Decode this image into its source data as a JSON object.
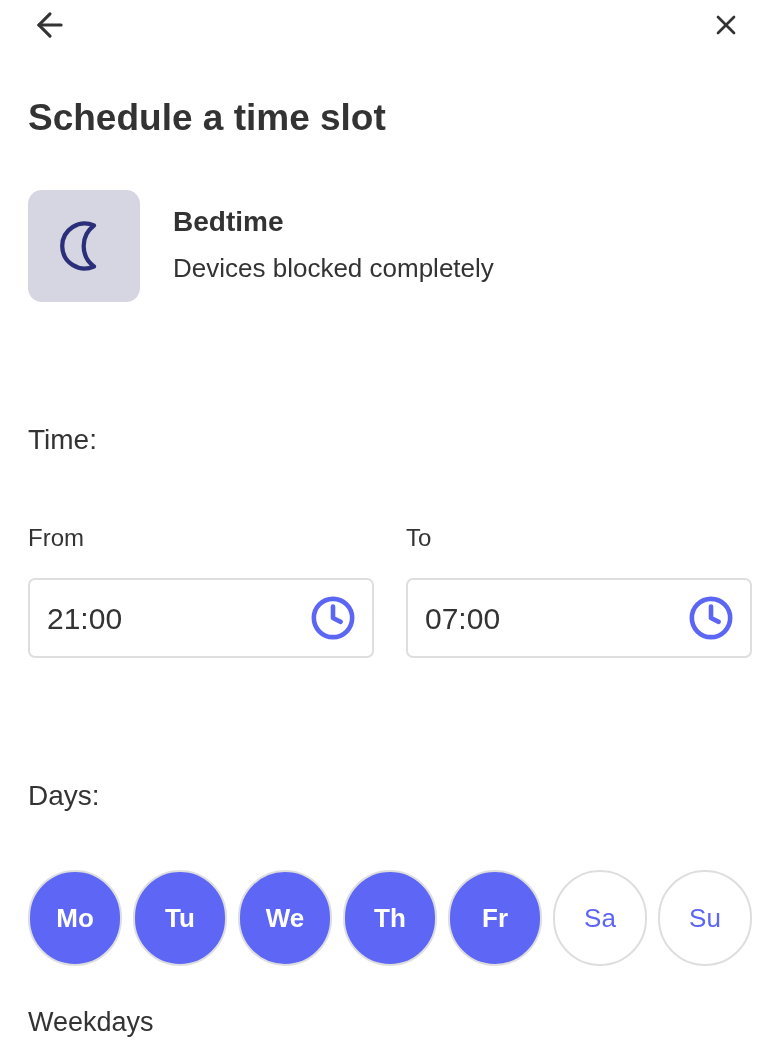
{
  "title": "Schedule a time slot",
  "mode": {
    "name": "Bedtime",
    "description": "Devices blocked completely"
  },
  "time": {
    "label": "Time:",
    "fields": [
      {
        "label": "From",
        "value": "21:00"
      },
      {
        "label": "To",
        "value": "07:00"
      }
    ]
  },
  "days": {
    "label": "Days:",
    "items": [
      {
        "label": "Mo",
        "selected": true
      },
      {
        "label": "Tu",
        "selected": true
      },
      {
        "label": "We",
        "selected": true
      },
      {
        "label": "Th",
        "selected": true
      },
      {
        "label": "Fr",
        "selected": true
      },
      {
        "label": "Sa",
        "selected": false
      },
      {
        "label": "Su",
        "selected": false
      }
    ],
    "summary": "Weekdays"
  }
}
